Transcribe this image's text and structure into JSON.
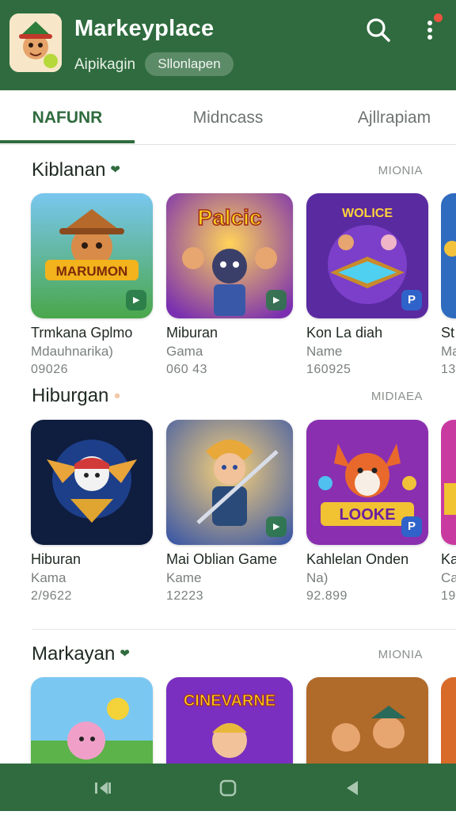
{
  "header": {
    "title": "Markeyplace",
    "subtitle": "Aipikagin",
    "chip": "Sllonlapen",
    "search_icon": "search-icon",
    "menu_icon": "more-vert-icon"
  },
  "tabs": [
    {
      "label": "NAFUNR",
      "active": true
    },
    {
      "label": "Midncass",
      "active": false
    },
    {
      "label": "Ajllrapiam",
      "active": false
    }
  ],
  "sections": [
    {
      "title": "Kiblanan",
      "more": "MIONIA",
      "items": [
        {
          "name": "Trmkana Gplmo",
          "sub": "Mdauhnarika)",
          "num": "09026",
          "art": "MARUMON"
        },
        {
          "name": "Miburan",
          "sub": "Gama",
          "num": "060 43",
          "art": "Palcic"
        },
        {
          "name": "Kon La diah",
          "sub": "Name",
          "num": "160925",
          "art": "WOLICE"
        },
        {
          "name": "St",
          "sub": "Ma",
          "num": "13",
          "art": ""
        }
      ]
    },
    {
      "title": "Hiburgan",
      "more": "MIDIAEA",
      "items": [
        {
          "name": "Hiburan",
          "sub": "Kama",
          "num": "2/9622",
          "art": ""
        },
        {
          "name": "Mai Oblian Game",
          "sub": "Kame",
          "num": "12223",
          "art": ""
        },
        {
          "name": "Kahlelan Onden",
          "sub": "Na)",
          "num": "92.899",
          "art": "LOOKE"
        },
        {
          "name": "Ka",
          "sub": "Ca",
          "num": "19",
          "art": ""
        }
      ]
    },
    {
      "title": "Markayan",
      "more": "MIONIA",
      "items": [
        {
          "name": "",
          "sub": "",
          "num": "",
          "art": ""
        },
        {
          "name": "",
          "sub": "",
          "num": "",
          "art": "CINEVARNE"
        },
        {
          "name": "",
          "sub": "",
          "num": "",
          "art": ""
        },
        {
          "name": "",
          "sub": "",
          "num": "",
          "art": ""
        }
      ]
    }
  ],
  "navbar": {
    "icons": [
      "recents-icon",
      "home-icon",
      "back-icon"
    ]
  },
  "colors": {
    "brand": "#2f6b3e",
    "accent": "#e8523f",
    "badge_blue": "#2f63c9"
  }
}
